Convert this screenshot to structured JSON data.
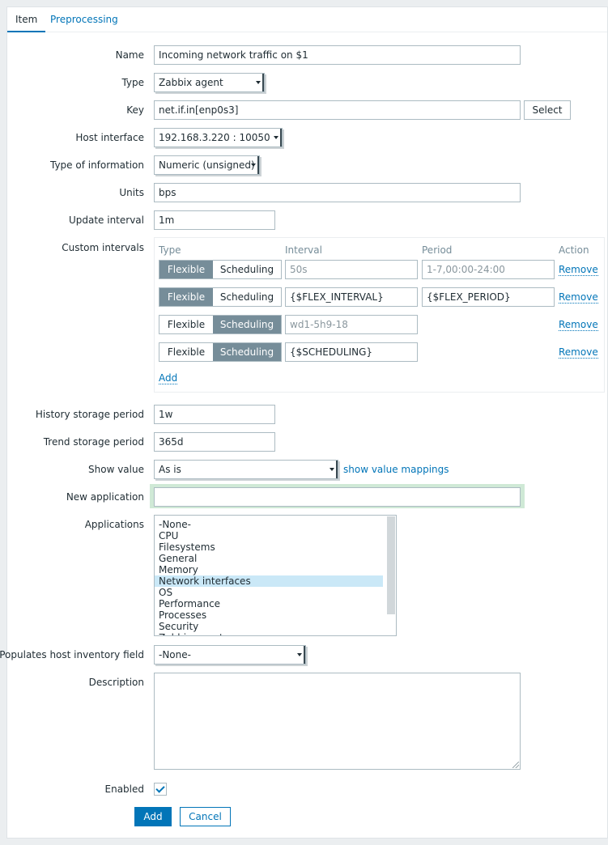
{
  "tabs": [
    {
      "label": "Item"
    },
    {
      "label": "Preprocessing"
    }
  ],
  "form": {
    "name": {
      "label": "Name",
      "value": "Incoming network traffic on $1"
    },
    "type": {
      "label": "Type",
      "value": "Zabbix agent"
    },
    "key": {
      "label": "Key",
      "value": "net.if.in[enp0s3]",
      "button": "Select"
    },
    "host_interface": {
      "label": "Host interface",
      "value": "192.168.3.220 : 10050"
    },
    "type_of_information": {
      "label": "Type of information",
      "value": "Numeric (unsigned)"
    },
    "units": {
      "label": "Units",
      "value": "bps"
    },
    "update_interval": {
      "label": "Update interval",
      "value": "1m"
    },
    "custom_intervals": {
      "label": "Custom intervals",
      "headers": {
        "type": "Type",
        "interval": "Interval",
        "period": "Period",
        "action": "Action"
      },
      "flexible_label": "Flexible",
      "scheduling_label": "Scheduling",
      "remove_label": "Remove",
      "add_label": "Add",
      "rows": [
        {
          "mode": "flexible",
          "interval": "50s",
          "interval_is_placeholder": true,
          "period": "1-7,00:00-24:00",
          "period_is_placeholder": true
        },
        {
          "mode": "flexible",
          "interval": "{$FLEX_INTERVAL}",
          "interval_is_placeholder": false,
          "period": "{$FLEX_PERIOD}",
          "period_is_placeholder": false
        },
        {
          "mode": "scheduling",
          "interval": "wd1-5h9-18",
          "interval_is_placeholder": true
        },
        {
          "mode": "scheduling",
          "interval": "{$SCHEDULING}",
          "interval_is_placeholder": false
        }
      ]
    },
    "history_storage": {
      "label": "History storage period",
      "value": "1w"
    },
    "trend_storage": {
      "label": "Trend storage period",
      "value": "365d"
    },
    "show_value": {
      "label": "Show value",
      "value": "As is",
      "link": "show value mappings"
    },
    "new_application": {
      "label": "New application",
      "value": ""
    },
    "applications": {
      "label": "Applications",
      "options": [
        "-None-",
        "CPU",
        "Filesystems",
        "General",
        "Memory",
        "Network interfaces",
        "OS",
        "Performance",
        "Processes",
        "Security",
        "Zabbix agent"
      ],
      "selected": "Network interfaces"
    },
    "populates_inventory": {
      "label": "Populates host inventory field",
      "value": "-None-"
    },
    "description": {
      "label": "Description",
      "value": ""
    },
    "enabled": {
      "label": "Enabled",
      "checked": true
    }
  },
  "buttons": {
    "add": "Add",
    "cancel": "Cancel"
  },
  "colors": {
    "accent": "#0275b8",
    "segment_active": "#768d99",
    "selection": "#cae8f7",
    "focus_glow": "#cfe9d6"
  }
}
